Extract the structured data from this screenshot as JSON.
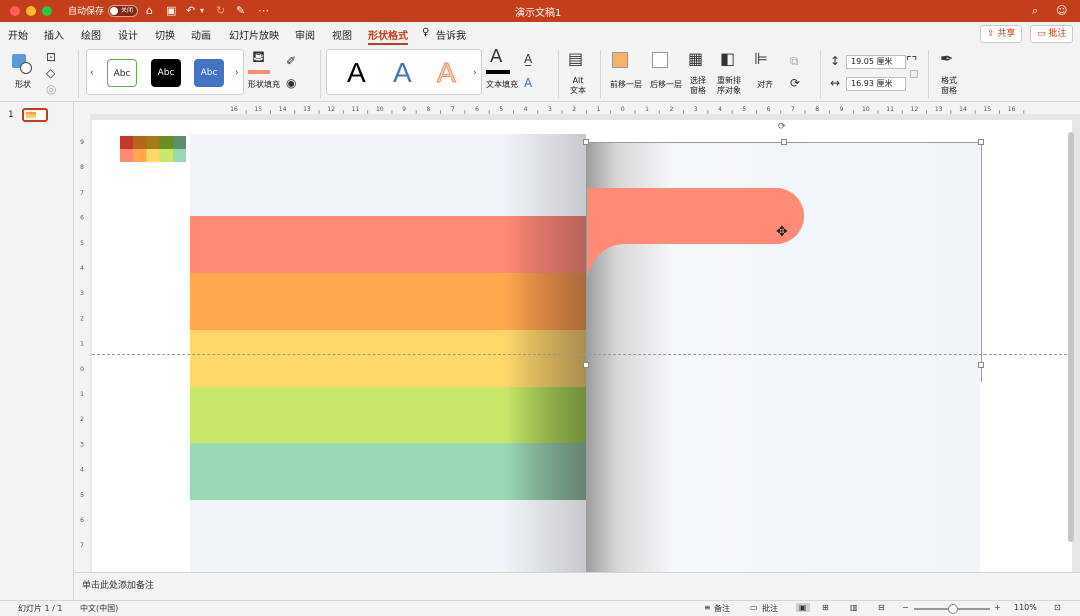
{
  "title_bar": {
    "autosave_label": "自动保存",
    "autosave_state": "关闭",
    "document_title": "演示文稿1"
  },
  "tabs": [
    "开始",
    "插入",
    "绘图",
    "设计",
    "切换",
    "动画",
    "幻灯片放映",
    "审阅",
    "视图",
    "形状格式"
  ],
  "tell_me": "告诉我",
  "share_label": "共享",
  "comment_label": "批注",
  "ribbon": {
    "shape_label": "形状",
    "style_abc": [
      "Abc",
      "Abc",
      "Abc"
    ],
    "fill_label": "形状填充",
    "wordart_letters": [
      "A",
      "A",
      "A"
    ],
    "text_fill_label": "文本填充",
    "alt_text_label_1": "Alt",
    "alt_text_label_2": "文本",
    "bring_forward_label": "前移一层",
    "send_backward_label": "后移一层",
    "selection_pane_label_1": "选择",
    "selection_pane_label_2": "窗格",
    "reorder_label_1": "重新排",
    "reorder_label_2": "序对象",
    "align_label": "对齐",
    "height_value": "19.05 厘米",
    "width_value": "16.93 厘米",
    "format_pane_label_1": "格式",
    "format_pane_label_2": "窗格"
  },
  "colors": {
    "accent": "#C43E1C",
    "ribbon_bg": "#F3F3F3",
    "stripes": [
      "#FF8A76",
      "#FFA84E",
      "#FFD86A",
      "#C9E86A",
      "#9BD8B4"
    ]
  },
  "ruler_h_labels": [
    "16",
    "15",
    "14",
    "13",
    "12",
    "11",
    "10",
    "9",
    "8",
    "7",
    "6",
    "5",
    "4",
    "3",
    "2",
    "1",
    "0",
    "1",
    "2",
    "3",
    "4",
    "5",
    "6",
    "7",
    "8",
    "9",
    "10",
    "11",
    "12",
    "13",
    "14",
    "15",
    "16"
  ],
  "ruler_v_labels": [
    "9",
    "8",
    "7",
    "6",
    "5",
    "4",
    "3",
    "2",
    "1",
    "0",
    "1",
    "2",
    "3",
    "4",
    "5",
    "6",
    "7"
  ],
  "thumbnail_number": "1",
  "notes_placeholder": "单击此处添加备注",
  "status": {
    "slide_count": "幻灯片 1 / 1",
    "language": "中文(中国)",
    "notes_btn": "备注",
    "comments_btn": "批注",
    "zoom": "110%"
  }
}
